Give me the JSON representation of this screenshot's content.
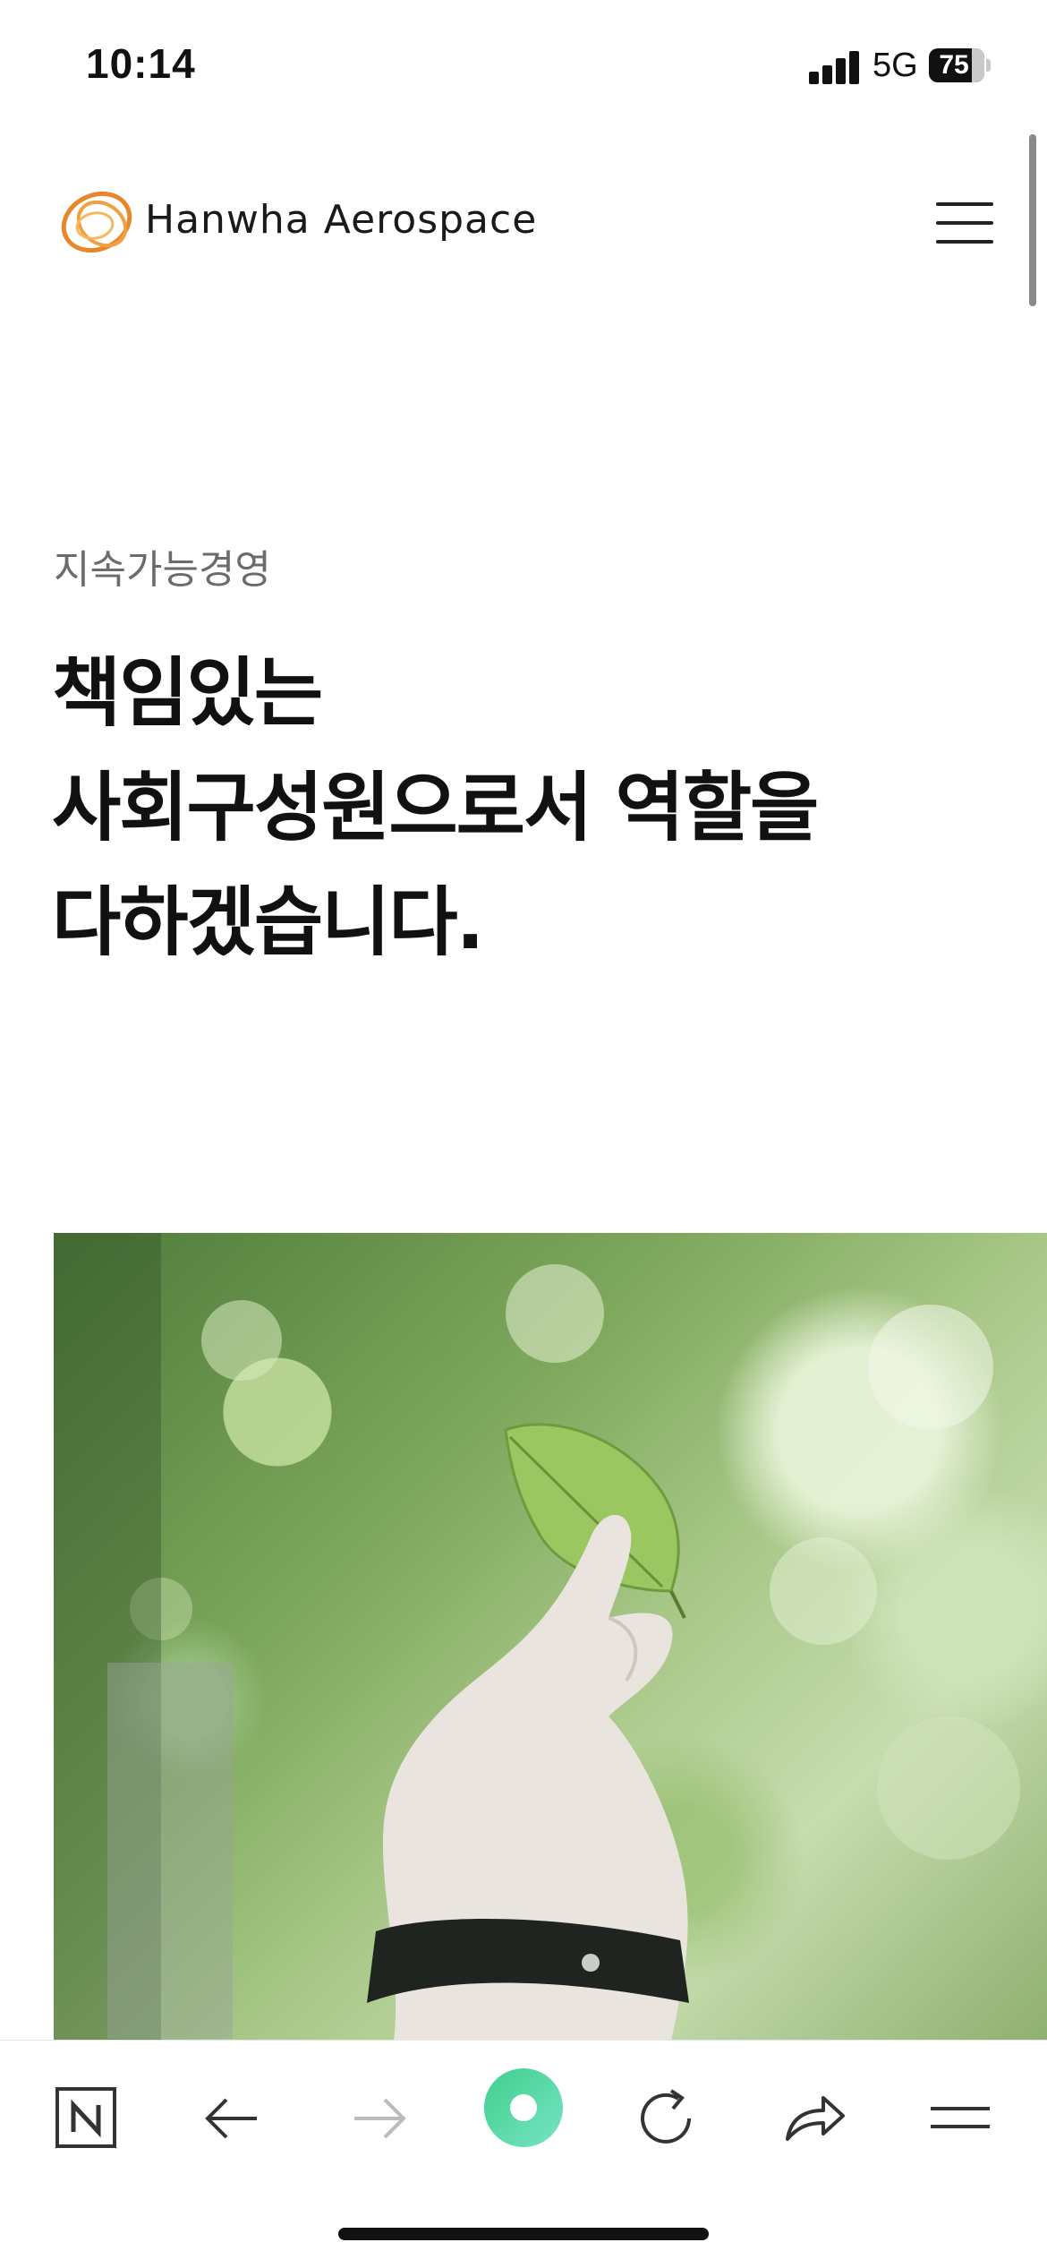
{
  "status_bar": {
    "time": "10:14",
    "network": "5G",
    "battery": "75"
  },
  "header": {
    "brand": "Hanwha Aerospace",
    "logo_icon": "hanwha-flame-logo",
    "menu_icon": "hamburger-menu-icon",
    "brand_color": "#e8862a"
  },
  "hero": {
    "eyebrow": "지속가능경영",
    "headline_lines": [
      "책임있는",
      "사회구성원으로서 역할을",
      "다하겠습니다."
    ],
    "image_subject": "hand-holding-green-leaf"
  },
  "toolbar": {
    "buttons": [
      "naver-n-icon",
      "back-arrow-icon",
      "forward-arrow-icon",
      "green-dot-home-icon",
      "reload-icon",
      "share-icon",
      "menu-icon"
    ],
    "accent": "#4fd6a0"
  }
}
